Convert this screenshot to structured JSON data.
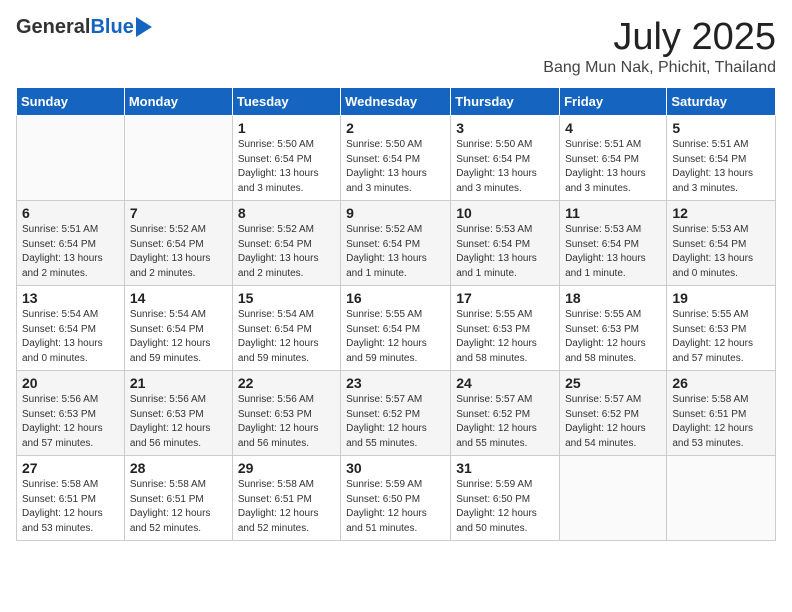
{
  "header": {
    "logo_general": "General",
    "logo_blue": "Blue",
    "month": "July 2025",
    "location": "Bang Mun Nak, Phichit, Thailand"
  },
  "weekdays": [
    "Sunday",
    "Monday",
    "Tuesday",
    "Wednesday",
    "Thursday",
    "Friday",
    "Saturday"
  ],
  "weeks": [
    [
      {
        "day": "",
        "info": ""
      },
      {
        "day": "",
        "info": ""
      },
      {
        "day": "1",
        "info": "Sunrise: 5:50 AM\nSunset: 6:54 PM\nDaylight: 13 hours and 3 minutes."
      },
      {
        "day": "2",
        "info": "Sunrise: 5:50 AM\nSunset: 6:54 PM\nDaylight: 13 hours and 3 minutes."
      },
      {
        "day": "3",
        "info": "Sunrise: 5:50 AM\nSunset: 6:54 PM\nDaylight: 13 hours and 3 minutes."
      },
      {
        "day": "4",
        "info": "Sunrise: 5:51 AM\nSunset: 6:54 PM\nDaylight: 13 hours and 3 minutes."
      },
      {
        "day": "5",
        "info": "Sunrise: 5:51 AM\nSunset: 6:54 PM\nDaylight: 13 hours and 3 minutes."
      }
    ],
    [
      {
        "day": "6",
        "info": "Sunrise: 5:51 AM\nSunset: 6:54 PM\nDaylight: 13 hours and 2 minutes."
      },
      {
        "day": "7",
        "info": "Sunrise: 5:52 AM\nSunset: 6:54 PM\nDaylight: 13 hours and 2 minutes."
      },
      {
        "day": "8",
        "info": "Sunrise: 5:52 AM\nSunset: 6:54 PM\nDaylight: 13 hours and 2 minutes."
      },
      {
        "day": "9",
        "info": "Sunrise: 5:52 AM\nSunset: 6:54 PM\nDaylight: 13 hours and 1 minute."
      },
      {
        "day": "10",
        "info": "Sunrise: 5:53 AM\nSunset: 6:54 PM\nDaylight: 13 hours and 1 minute."
      },
      {
        "day": "11",
        "info": "Sunrise: 5:53 AM\nSunset: 6:54 PM\nDaylight: 13 hours and 1 minute."
      },
      {
        "day": "12",
        "info": "Sunrise: 5:53 AM\nSunset: 6:54 PM\nDaylight: 13 hours and 0 minutes."
      }
    ],
    [
      {
        "day": "13",
        "info": "Sunrise: 5:54 AM\nSunset: 6:54 PM\nDaylight: 13 hours and 0 minutes."
      },
      {
        "day": "14",
        "info": "Sunrise: 5:54 AM\nSunset: 6:54 PM\nDaylight: 12 hours and 59 minutes."
      },
      {
        "day": "15",
        "info": "Sunrise: 5:54 AM\nSunset: 6:54 PM\nDaylight: 12 hours and 59 minutes."
      },
      {
        "day": "16",
        "info": "Sunrise: 5:55 AM\nSunset: 6:54 PM\nDaylight: 12 hours and 59 minutes."
      },
      {
        "day": "17",
        "info": "Sunrise: 5:55 AM\nSunset: 6:53 PM\nDaylight: 12 hours and 58 minutes."
      },
      {
        "day": "18",
        "info": "Sunrise: 5:55 AM\nSunset: 6:53 PM\nDaylight: 12 hours and 58 minutes."
      },
      {
        "day": "19",
        "info": "Sunrise: 5:55 AM\nSunset: 6:53 PM\nDaylight: 12 hours and 57 minutes."
      }
    ],
    [
      {
        "day": "20",
        "info": "Sunrise: 5:56 AM\nSunset: 6:53 PM\nDaylight: 12 hours and 57 minutes."
      },
      {
        "day": "21",
        "info": "Sunrise: 5:56 AM\nSunset: 6:53 PM\nDaylight: 12 hours and 56 minutes."
      },
      {
        "day": "22",
        "info": "Sunrise: 5:56 AM\nSunset: 6:53 PM\nDaylight: 12 hours and 56 minutes."
      },
      {
        "day": "23",
        "info": "Sunrise: 5:57 AM\nSunset: 6:52 PM\nDaylight: 12 hours and 55 minutes."
      },
      {
        "day": "24",
        "info": "Sunrise: 5:57 AM\nSunset: 6:52 PM\nDaylight: 12 hours and 55 minutes."
      },
      {
        "day": "25",
        "info": "Sunrise: 5:57 AM\nSunset: 6:52 PM\nDaylight: 12 hours and 54 minutes."
      },
      {
        "day": "26",
        "info": "Sunrise: 5:58 AM\nSunset: 6:51 PM\nDaylight: 12 hours and 53 minutes."
      }
    ],
    [
      {
        "day": "27",
        "info": "Sunrise: 5:58 AM\nSunset: 6:51 PM\nDaylight: 12 hours and 53 minutes."
      },
      {
        "day": "28",
        "info": "Sunrise: 5:58 AM\nSunset: 6:51 PM\nDaylight: 12 hours and 52 minutes."
      },
      {
        "day": "29",
        "info": "Sunrise: 5:58 AM\nSunset: 6:51 PM\nDaylight: 12 hours and 52 minutes."
      },
      {
        "day": "30",
        "info": "Sunrise: 5:59 AM\nSunset: 6:50 PM\nDaylight: 12 hours and 51 minutes."
      },
      {
        "day": "31",
        "info": "Sunrise: 5:59 AM\nSunset: 6:50 PM\nDaylight: 12 hours and 50 minutes."
      },
      {
        "day": "",
        "info": ""
      },
      {
        "day": "",
        "info": ""
      }
    ]
  ]
}
